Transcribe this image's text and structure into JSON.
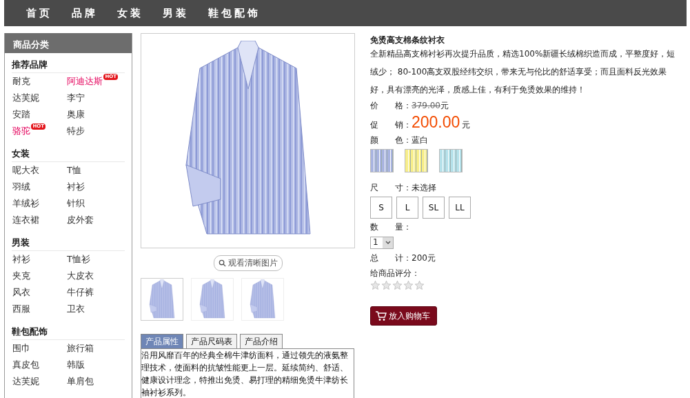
{
  "nav": [
    "首页",
    "品牌",
    "女装",
    "男装",
    "鞋包配饰"
  ],
  "sidebar": {
    "title": "商品分类",
    "groups": [
      {
        "title": "推荐品牌",
        "items": [
          {
            "label": "耐克"
          },
          {
            "label": "阿迪达斯",
            "badge": "HOT"
          },
          {
            "label": "达芙妮"
          },
          {
            "label": "李宁"
          },
          {
            "label": "安踏"
          },
          {
            "label": "奥康"
          },
          {
            "label": "骆驼",
            "badge": "HOT"
          },
          {
            "label": "特步"
          }
        ]
      },
      {
        "title": "女装",
        "items": [
          {
            "label": "呢大衣"
          },
          {
            "label": "T恤"
          },
          {
            "label": "羽绒"
          },
          {
            "label": "衬衫"
          },
          {
            "label": "羊绒衫"
          },
          {
            "label": "针织"
          },
          {
            "label": "连衣裙"
          },
          {
            "label": "皮外套"
          }
        ]
      },
      {
        "title": "男装",
        "items": [
          {
            "label": "衬衫"
          },
          {
            "label": "T恤衫"
          },
          {
            "label": "夹克"
          },
          {
            "label": "大皮衣"
          },
          {
            "label": "风衣"
          },
          {
            "label": "牛仔裤"
          },
          {
            "label": "西服"
          },
          {
            "label": "卫衣"
          }
        ]
      },
      {
        "title": "鞋包配饰",
        "items": [
          {
            "label": "围巾"
          },
          {
            "label": "旅行箱"
          },
          {
            "label": "真皮包"
          },
          {
            "label": "韩版"
          },
          {
            "label": "达芙妮"
          },
          {
            "label": "单肩包"
          }
        ]
      }
    ]
  },
  "gallery": {
    "zoom_link": "观看清晰图片",
    "thumbnails": [
      {
        "selected": true
      },
      {
        "selected": false
      },
      {
        "selected": false
      }
    ]
  },
  "detail_tabs": [
    {
      "label": "产品属性",
      "selected": true
    },
    {
      "label": "产品尺码表",
      "selected": false
    },
    {
      "label": "产品介绍",
      "selected": false
    }
  ],
  "detail_text": "沿用风靡百年的经典全棉牛津纺面料，通过领先的液氨整理技术，使面料的抗皱性能更上一层。延续简约、舒适、健康设计理念，特推出免烫、易打理的精细免烫牛津纺长袖衬衫系列。",
  "product": {
    "title": "免烫高支棉条纹衬衣",
    "description": "全新精品高支棉衬衫再次提升品质，精选100%新疆长绒棉织造而成，平整度好，短绒少； 80-100高支双股经纬交织，带来无与伦比的舒适享受；而且面料反光效果好，具有漂亮的光泽，质感上佳，有利于免烫效果的维持！",
    "price_label": "价　　格：",
    "price": "379.00",
    "price_unit": "元",
    "promo_label": "促　　销：",
    "promo": "200.00",
    "promo_unit": "元",
    "color_label": "颜　　色：",
    "color_value": "蓝白",
    "swatches": [
      {
        "color": "#a9b4e0",
        "selected": false
      },
      {
        "color": "#f7ee8a",
        "selected": false
      },
      {
        "color": "#b5e1ea",
        "selected": false
      }
    ],
    "size_label": "尺　　寸：",
    "size_value": "未选择",
    "sizes": [
      {
        "label": "S",
        "selected": false
      },
      {
        "label": "L",
        "selected": false
      },
      {
        "label": "SL",
        "selected": false
      },
      {
        "label": "LL",
        "selected": false
      }
    ],
    "qty_label": "数　　量：",
    "qty": "1",
    "total_label": "总　　计：",
    "total": "200元",
    "rating_label": "给商品评分：",
    "stars": 0,
    "cart_button": "放入购物车"
  }
}
